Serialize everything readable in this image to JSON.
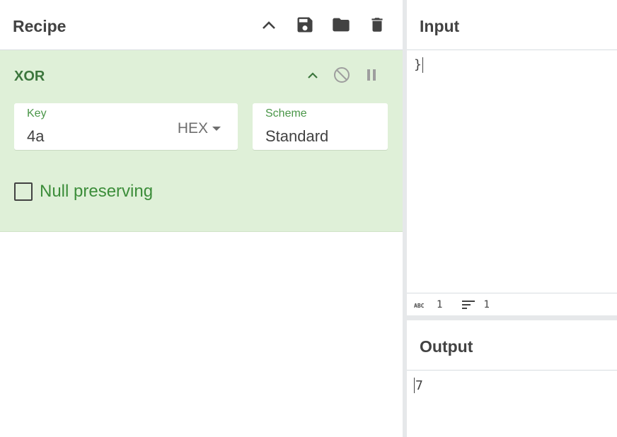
{
  "recipe": {
    "title": "Recipe",
    "operation": {
      "name": "XOR",
      "key": {
        "label": "Key",
        "value": "4a",
        "format": "HEX"
      },
      "scheme": {
        "label": "Scheme",
        "value": "Standard"
      },
      "null_preserving": {
        "label": "Null preserving",
        "checked": false
      }
    }
  },
  "input": {
    "title": "Input",
    "text": "}",
    "stats": {
      "chars": "1",
      "lines": "1"
    }
  },
  "output": {
    "title": "Output",
    "text": "7"
  },
  "icons": {
    "collapse": "chevron-up-icon",
    "save": "save-icon",
    "load": "folder-icon",
    "clear": "trash-icon",
    "disable": "disable-icon",
    "breakpoint": "pause-icon",
    "chars": "abc-icon",
    "lines": "lines-icon"
  },
  "colors": {
    "operation_bg": "#dff0d8",
    "operation_text": "#3c763d",
    "field_label": "#4a9648"
  }
}
